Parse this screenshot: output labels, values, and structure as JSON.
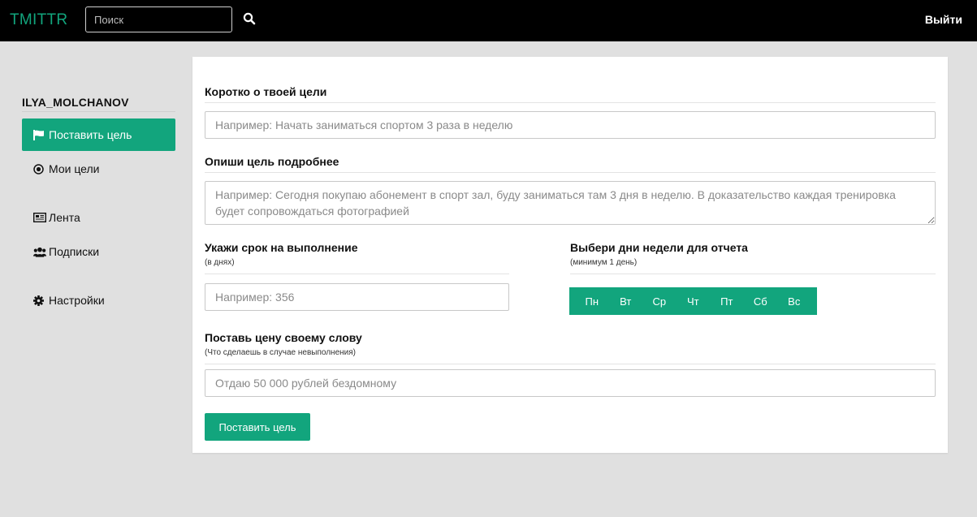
{
  "header": {
    "brand": "TMITTR",
    "search_placeholder": "Поиск",
    "logout_label": "Выйти"
  },
  "sidebar": {
    "username": "ILYA_MOLCHANOV",
    "items": [
      {
        "label": "Поставить цель",
        "icon": "flag-icon"
      },
      {
        "label": "Мои цели",
        "icon": "target-icon"
      },
      {
        "label": "Лента",
        "icon": "newspaper-icon"
      },
      {
        "label": "Подписки",
        "icon": "users-icon"
      },
      {
        "label": "Настройки",
        "icon": "gear-icon"
      }
    ]
  },
  "form": {
    "short_title": "Коротко о твоей цели",
    "short_placeholder": "Например: Начать заниматься спортом 3 раза в неделю",
    "detail_title": "Опиши цель подробнее",
    "detail_placeholder": "Например: Сегодня покупаю абонемент в спорт зал, буду заниматься там 3 дня в неделю. В доказательство каждая тренировка будет сопровождаться фотографией",
    "deadline_title": "Укажи срок на выполнение",
    "deadline_sub": "(в днях)",
    "deadline_placeholder": "Например: 356",
    "days_title": "Выбери дни недели для отчета",
    "days_sub": "(минимум 1 день)",
    "days": [
      "Пн",
      "Вт",
      "Ср",
      "Чт",
      "Пт",
      "Сб",
      "Вс"
    ],
    "price_title": "Поставь цену своему слову",
    "price_sub": "(Что сделаешь в случае невыполнения)",
    "price_placeholder": "Отдаю 50 000 рублей бездомному",
    "submit_label": "Поставить цель"
  },
  "colors": {
    "accent": "#12a57d",
    "topbar": "#000000",
    "background": "#e0e0e0"
  }
}
